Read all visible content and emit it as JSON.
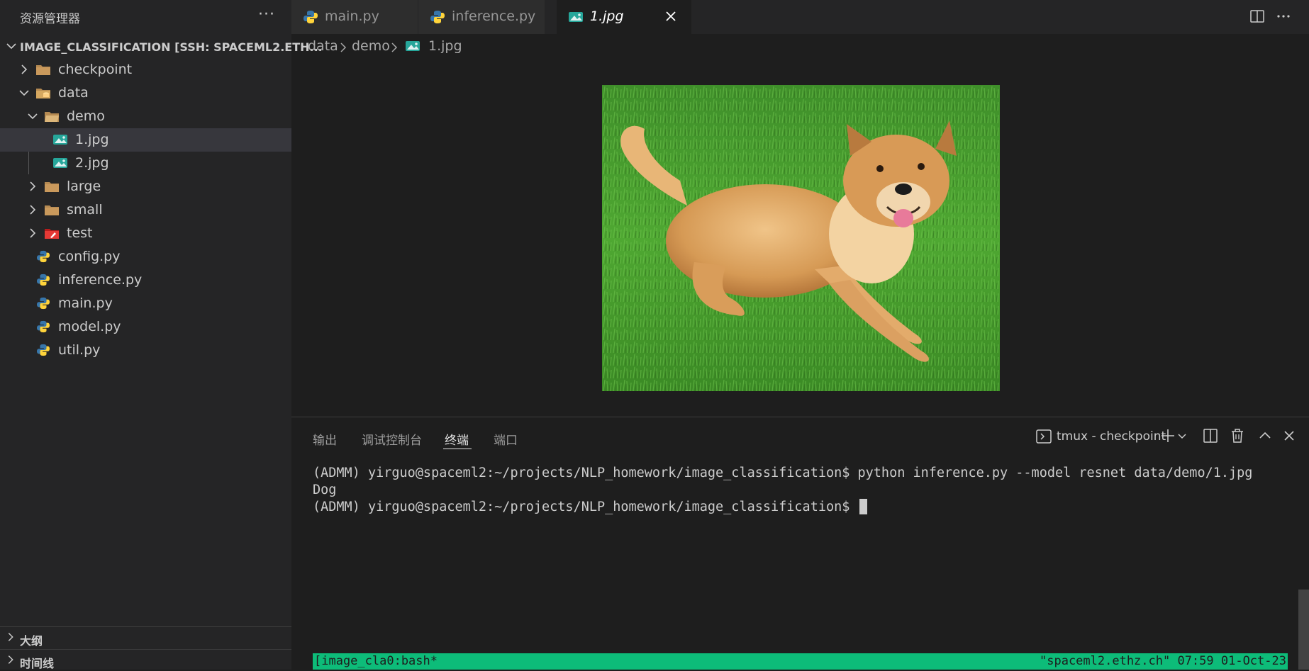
{
  "sidebar": {
    "title": "资源管理器",
    "more": "···",
    "section_title": "IMAGE_CLASSIFICATION [SSH: SPACEML2.ETH...",
    "tree": [
      {
        "label": "checkpoint",
        "kind": "folder",
        "depth": 0,
        "expanded": false
      },
      {
        "label": "data",
        "kind": "folder",
        "depth": 0,
        "expanded": true
      },
      {
        "label": "demo",
        "kind": "folder",
        "depth": 1,
        "expanded": true
      },
      {
        "label": "1.jpg",
        "kind": "image",
        "depth": 2,
        "selected": true
      },
      {
        "label": "2.jpg",
        "kind": "image",
        "depth": 2
      },
      {
        "label": "large",
        "kind": "folder",
        "depth": 1,
        "expanded": false
      },
      {
        "label": "small",
        "kind": "folder",
        "depth": 1,
        "expanded": false
      },
      {
        "label": "test",
        "kind": "test-folder",
        "depth": 1,
        "expanded": false
      },
      {
        "label": "config.py",
        "kind": "python",
        "depth": 0
      },
      {
        "label": "inference.py",
        "kind": "python",
        "depth": 0
      },
      {
        "label": "main.py",
        "kind": "python",
        "depth": 0
      },
      {
        "label": "model.py",
        "kind": "python",
        "depth": 0
      },
      {
        "label": "util.py",
        "kind": "python",
        "depth": 0
      }
    ],
    "outline": "大纲",
    "timeline": "时间线"
  },
  "tabs": [
    {
      "label": "main.py",
      "icon": "python-icon"
    },
    {
      "label": "inference.py",
      "icon": "python-icon"
    },
    {
      "label": "1.jpg",
      "icon": "image-icon",
      "active": true
    }
  ],
  "breadcrumb": [
    "data",
    "demo",
    "1.jpg"
  ],
  "panel": {
    "tabs": [
      "输出",
      "调试控制台",
      "终端",
      "端口"
    ],
    "active_tab": "终端",
    "terminal_name": "tmux - checkpoint"
  },
  "terminal": {
    "lines": [
      "(ADMM) yirguo@spaceml2:~/projects/NLP_homework/image_classification$ python inference.py --model resnet data/demo/1.jpg",
      "Dog",
      "(ADMM) yirguo@spaceml2:~/projects/NLP_homework/image_classification$ "
    ],
    "status_left": "[image_cla0:bash*",
    "status_right": "\"spaceml2.ethz.ch\" 07:59 01-Oct-23"
  },
  "colors": {
    "sidebar_bg": "#252526",
    "editor_bg": "#1e1e1e",
    "tmux_green": "#0dbc79",
    "folder": "#dcb67a",
    "image_icon": "#26a69a",
    "test_icon": "#e53935"
  }
}
